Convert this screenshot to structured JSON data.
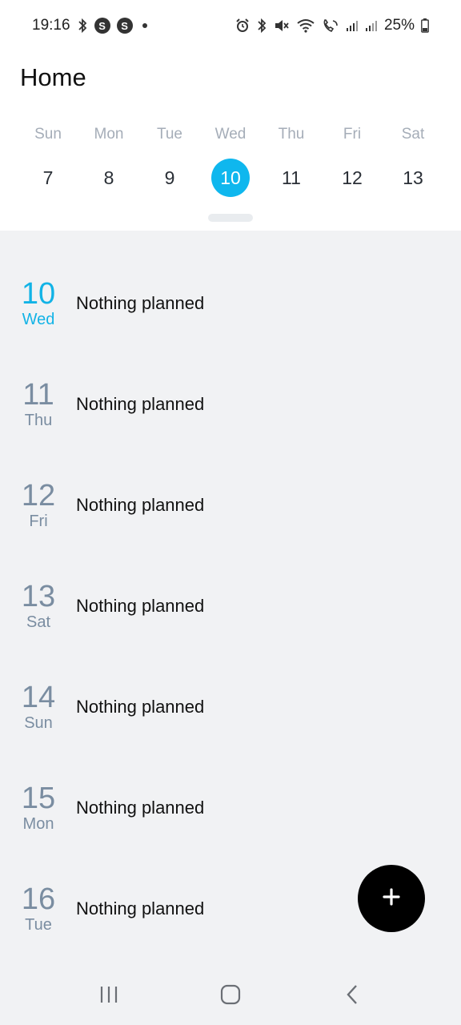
{
  "status_bar": {
    "time": "19:16",
    "battery": "25%",
    "icons_left": [
      "bluetooth-icon",
      "s-badge-icon",
      "s-badge-icon",
      "notification-dot-icon"
    ],
    "icons_right": [
      "alarm-icon",
      "bluetooth-icon",
      "mute-icon",
      "wifi-icon",
      "call-icon",
      "signal-icon",
      "signal-icon",
      "battery-icon"
    ]
  },
  "header": {
    "title": "Home"
  },
  "week": {
    "days": [
      {
        "name": "Sun",
        "date": "7"
      },
      {
        "name": "Mon",
        "date": "8"
      },
      {
        "name": "Tue",
        "date": "9"
      },
      {
        "name": "Wed",
        "date": "10",
        "selected": true
      },
      {
        "name": "Thu",
        "date": "11"
      },
      {
        "name": "Fri",
        "date": "12"
      },
      {
        "name": "Sat",
        "date": "13"
      }
    ]
  },
  "agenda": {
    "rows": [
      {
        "day_num": "10",
        "day_name": "Wed",
        "text": "Nothing planned",
        "today": true
      },
      {
        "day_num": "11",
        "day_name": "Thu",
        "text": "Nothing planned"
      },
      {
        "day_num": "12",
        "day_name": "Fri",
        "text": "Nothing planned"
      },
      {
        "day_num": "13",
        "day_name": "Sat",
        "text": "Nothing planned"
      },
      {
        "day_num": "14",
        "day_name": "Sun",
        "text": "Nothing planned"
      },
      {
        "day_num": "15",
        "day_name": "Mon",
        "text": "Nothing planned"
      },
      {
        "day_num": "16",
        "day_name": "Tue",
        "text": "Nothing planned"
      }
    ]
  },
  "fab": {
    "icon": "plus-icon"
  },
  "nav": {
    "icons": [
      "recent-apps-icon",
      "home-icon",
      "back-icon"
    ]
  },
  "colors": {
    "accent": "#0fb7ee",
    "muted": "#7a8da1",
    "agenda_bg": "#f1f2f4",
    "fab": "#000000"
  }
}
